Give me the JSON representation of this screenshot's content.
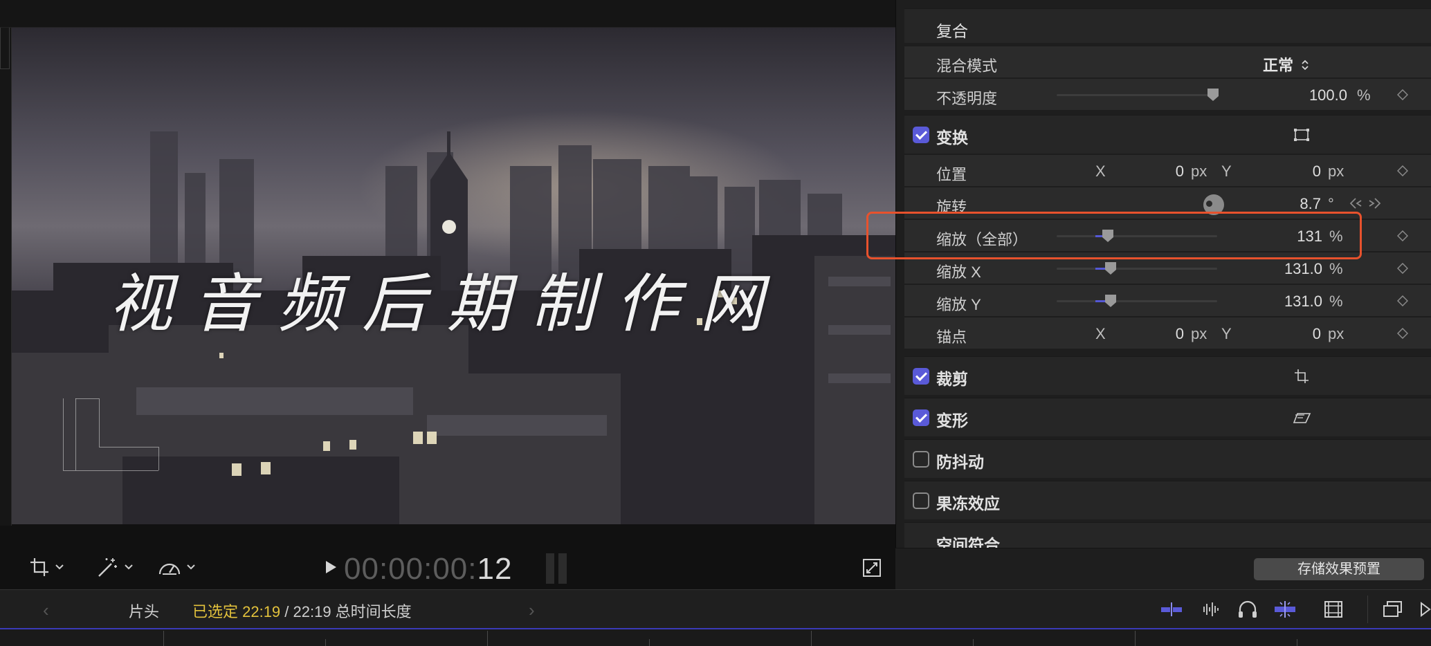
{
  "viewer": {
    "title_overlay": "视音频后期制作网",
    "timecode_dim": "00:00:00:",
    "timecode_frames": "12",
    "tools": [
      "crop-tool",
      "enhance-tool",
      "retime-tool"
    ]
  },
  "inspector": {
    "compound": {
      "title": "复合",
      "blend_mode_label": "混合模式",
      "blend_mode_value": "正常",
      "opacity_label": "不透明度",
      "opacity_value": "100.0",
      "opacity_unit": "%",
      "opacity_level": 1.0
    },
    "transform": {
      "title": "变换",
      "enabled": true,
      "position_label": "位置",
      "position_x_axis": "X",
      "position_x": "0",
      "position_x_unit": "px",
      "position_y_axis": "Y",
      "position_y": "0",
      "position_y_unit": "px",
      "rotation_label": "旋转",
      "rotation_value": "8.7",
      "rotation_unit": "°",
      "scale_all_label": "缩放（全部）",
      "scale_all_value": "131",
      "scale_all_unit": "%",
      "scale_x_label": "缩放 X",
      "scale_x_value": "131.0",
      "scale_x_unit": "%",
      "scale_y_label": "缩放 Y",
      "scale_y_value": "131.0",
      "scale_y_unit": "%",
      "anchor_label": "锚点",
      "anchor_x_axis": "X",
      "anchor_x": "0",
      "anchor_x_unit": "px",
      "anchor_y_axis": "Y",
      "anchor_y": "0",
      "anchor_y_unit": "px"
    },
    "crop": {
      "title": "裁剪",
      "enabled": true
    },
    "distort": {
      "title": "变形",
      "enabled": true
    },
    "stabilization": {
      "title": "防抖动",
      "enabled": false
    },
    "rolling_shutter": {
      "title": "果冻效应",
      "enabled": false
    },
    "spatial_conform": {
      "title": "空间符合"
    },
    "save_preset_label": "存储效果预置"
  },
  "timeline": {
    "clip_name": "片头",
    "selected_label": "已选定 22:19",
    "total_label": " / 22:19 总时间长度",
    "prev_arrow": "‹",
    "next_arrow": "›",
    "right_icons": [
      "clip-appearance-icon",
      "audio-waveform-icon",
      "headphones-icon",
      "snapping-icon",
      "filmstrip-icon",
      "windows-icon",
      "play-arrow-icon"
    ]
  },
  "colors": {
    "accent": "#5a5ad8",
    "highlight": "#e8522d",
    "selected_yellow": "#e3c23c"
  }
}
